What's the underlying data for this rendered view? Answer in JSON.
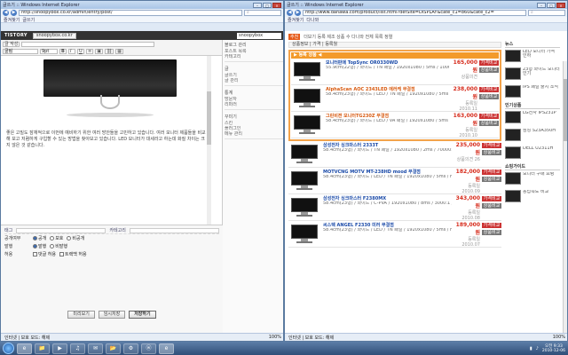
{
  "left": {
    "title": "글쓰기 :: Windows Internet Explorer",
    "url": "http://snoopybox.co.kr/admin/entry/post/",
    "search": "",
    "favorites": [
      "즐겨찾기",
      "글쓰기"
    ],
    "tistory": {
      "logo": "TISTORY",
      "blog": "snoopybox.co.kr",
      "user": "snoopybox"
    },
    "editor": {
      "title_label": "글 작성",
      "font_select": "굴림",
      "size_select": "9pt",
      "paragraph": "좋은 고밀도 잠재적으로 이번에 예비하기 위한 여러 방안들을 고민하고 있습니다. 여러 모니터 제품들을 비교해 보고 저렴하게 구입할 수 있는 방법을 찾아보고 있습니다. LED 모니터가 대세라고 하는데 화질 차이는 크지 않은 것 같습니다."
    },
    "tags": {
      "tag_label": "태그",
      "category_label": "카테고리"
    },
    "options": [
      {
        "label": "공개여부",
        "values": [
          "공개",
          "보호",
          "비공개"
        ]
      },
      {
        "label": "발행",
        "values": [
          "발행",
          "비발행"
        ]
      },
      {
        "label": "허용",
        "values": [
          "댓글 허용",
          "트랙백 허용"
        ]
      }
    ],
    "buttons": {
      "temp": "미리보기",
      "save": "임시저장",
      "publish": "저장하기"
    },
    "side": [
      {
        "head": "블로그 관리",
        "items": [
          "포스트 목록",
          "카테고리"
        ]
      },
      {
        "head": "글",
        "items": [
          "글쓰기",
          "글 관리"
        ]
      },
      {
        "head": "통계",
        "items": [
          "방문자",
          "리퍼러"
        ]
      },
      {
        "head": "꾸미기",
        "items": [
          "스킨",
          "플러그인",
          "메뉴 관리"
        ]
      }
    ],
    "status": "인터넷 | 보호 모드: 해제",
    "zoom": "100%"
  },
  "right": {
    "title": "글쓰기 :: Windows Internet Explorer",
    "url": "http://www.danawa.com/product/list.html?defSite=DISPLAY&cate_c1=860&cate_c2=",
    "search": "",
    "favorites": [
      "즐겨찾기",
      "다나와"
    ],
    "top": {
      "badge": "추천",
      "text": "더보기 등록 제조 상품 수 다나와 전체 목록 정렬"
    },
    "list_header": "상품정보 | 가격 | 등록월",
    "promo_title": "▶ 등록 상품 ◀",
    "products": [
      {
        "name": "모니터판매 TopSync OR0330WD",
        "spec": "55.9cm(22형) / 와이드 / TN 패널 / 1920x1080 / 5ms / 1000:1 / 250cd / D-SUB / DVI",
        "price": "165,000원",
        "meta": "상품의견",
        "hl": false,
        "btn1": "가격비교",
        "btn2": "상품비교"
      },
      {
        "name": "AlphaScan AOC 2343LED 에러케 무결점",
        "spec": "58.4cm(23형) / 와이드 / LED / TN 패널 / 1920x1080 / 5ms / 20000000:1 / D-SUB / DVI",
        "price": "238,000원",
        "meta": "등록일 2010.11",
        "hl": true,
        "btn1": "가격비교",
        "btn2": "상품비교"
      },
      {
        "name": "그린비젼 모니터TG230Z 무결점",
        "spec": "58.4cm(23형) / 와이드 / LED / VA 패널 / 1920x1080 / 5ms / HDMI",
        "price": "163,000원",
        "meta": "등록일 2010.10",
        "hl": true,
        "btn1": "가격비교",
        "btn2": "상품비교"
      },
      {
        "name": "삼성전자 싱크마스터 2333T",
        "spec": "58.4cm(23형) / 와이드 / TN 패널 / 1920x1080 / 2ms / 70000:1 / D-SUB / DVI",
        "price": "235,000원",
        "meta": "상품의견 26",
        "hl": false,
        "btn1": "가격비교",
        "btn2": "상품비교"
      },
      {
        "name": "MOTVCNG MOTV MT-238HD mood 무결점",
        "spec": "58.4cm(23형) / 와이드 / LED / TN 패널 / 1920x1080 / 5ms / HDMI / D-SUB",
        "price": "182,000원",
        "meta": "등록일 2010.09",
        "hl": false,
        "btn1": "가격비교",
        "btn2": "상품비교"
      },
      {
        "name": "삼성전자 싱크마스터 F2380MX",
        "spec": "58.4cm(23형) / 와이드 / C-PVA / 1920x1080 / 8ms / 3000:1 / D-SUB / DVI",
        "price": "343,000원",
        "meta": "등록일 2010.08",
        "hl": false,
        "btn1": "가격비교",
        "btn2": "상품비교"
      },
      {
        "name": "씨스텍 ANGEL F2330 미러 무결점",
        "spec": "58.4cm(23형) / 와이드 / LED / TN 패널 / 1920x1080 / 5ms / HDMI",
        "price": "189,000원",
        "meta": "등록일 2010.07",
        "hl": false,
        "btn1": "가격비교",
        "btn2": "상품비교"
      }
    ],
    "side": [
      {
        "head": "뉴스",
        "items": [
          "LED 모니터 가격 인하",
          "23형 와이드 모니터 인기",
          "IPS 패널 출시 소식"
        ]
      },
      {
        "head": "인기상품",
        "items": [
          "LG전자 IPS231P",
          "삼성 S23A350H",
          "DELL U2311H"
        ]
      },
      {
        "head": "쇼핑가이드",
        "items": [
          "모니터 구매 요령",
          "응답속도 비교"
        ]
      }
    ],
    "status": "인터넷 | 보호 모드: 해제",
    "zoom": "100%"
  },
  "taskbar": {
    "apps": [
      "e",
      "📁",
      "▶",
      "♫",
      "✉",
      "📂",
      "⚙",
      "ⓦ",
      "e"
    ],
    "time": "오전 9:33",
    "date": "2010-12-06"
  },
  "colors": {
    "accent": "#f39a2a",
    "price": "#d62a1a",
    "link": "#1a4aa8"
  }
}
